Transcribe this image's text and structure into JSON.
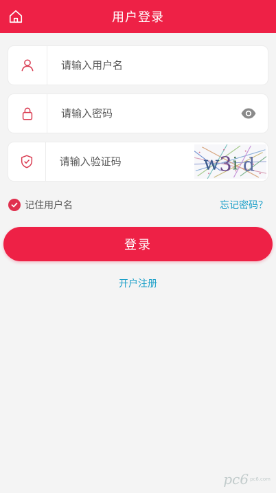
{
  "header": {
    "title": "用户登录",
    "home_icon": "home-icon"
  },
  "form": {
    "username": {
      "placeholder": "请输入用户名",
      "value": "",
      "icon": "user-icon"
    },
    "password": {
      "placeholder": "请输入密码",
      "value": "",
      "icon": "lock-icon",
      "toggle_icon": "eye-icon"
    },
    "captcha": {
      "placeholder": "请输入验证码",
      "value": "",
      "icon": "shield-icon",
      "image_text": "w3id"
    }
  },
  "options": {
    "remember_label": "记住用户名",
    "remember_checked": true,
    "forgot_label": "忘记密码？"
  },
  "actions": {
    "login_label": "登录",
    "register_label": "开户注册"
  },
  "watermark": {
    "text": "pc6",
    "small": "pc6.com"
  },
  "colors": {
    "primary": "#ee2146",
    "link": "#1da0c9",
    "background": "#f4f4f4"
  }
}
